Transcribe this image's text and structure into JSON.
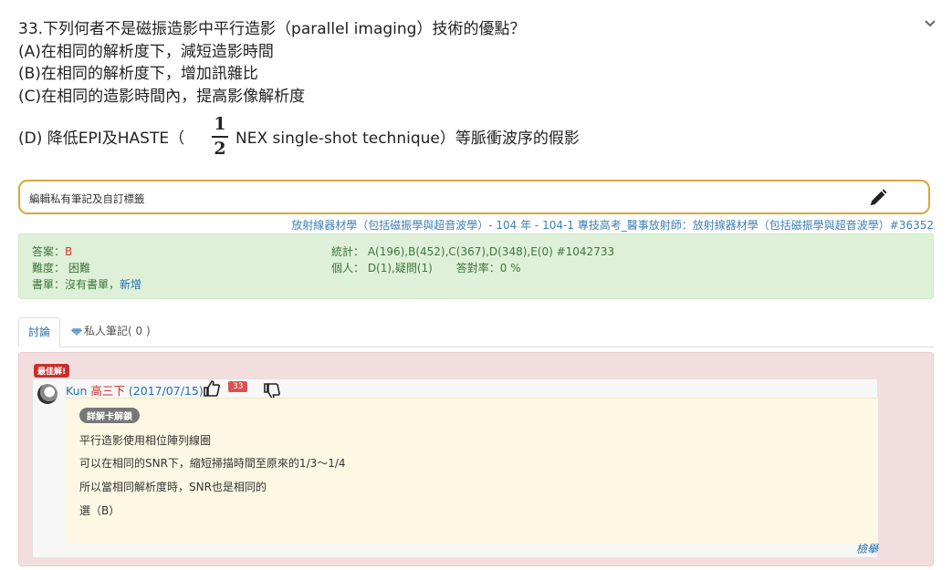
{
  "question": {
    "title": "33.下列何者不是磁振造影中平行造影（parallel imaging）技術的優點？",
    "option_a": "(A)在相同的解析度下，減短造影時間",
    "option_b": "(B)在相同的解析度下，增加訊雜比",
    "option_c": "(C)在相同的造影時間內，提高影像解析度",
    "option_d_prefix": "(D) 降低EPI及HASTE（",
    "option_d_frac_num": "1",
    "option_d_frac_den": "2",
    "option_d_suffix": "NEX single-shot technique）等脈衝波序的假影"
  },
  "note": {
    "label": "編輯私有筆記及自訂標籤"
  },
  "source": "放射線器材學（包括磁振學與超音波學）- 104 年 - 104-1 專技高考_醫事放射師：放射線器材學（包括磁振學與超音波學）#36352",
  "answer": {
    "answer_label": "答案：",
    "answer_value": "B",
    "difficulty": "難度： 困難",
    "book_label": "書單：沒有書單，",
    "book_link": "新增",
    "stats": "統計： A(196),B(452),C(367),D(348),E(0) #1042733",
    "personal": "個人： D(1),疑問(1)",
    "accuracy": "答對率：0 %"
  },
  "tabs": {
    "discussion": "討論",
    "private": "私人筆記( 0 )"
  },
  "discussion": {
    "best_badge": "最佳解!",
    "user": "Kun",
    "rank": "高三下",
    "date": "(2017/07/15)",
    "likes": "33",
    "tag": "詳解卡解鎖",
    "lines": [
      "平行造影使用相位陣列線圈",
      "可以在相同的SNR下，縮短掃描時間至原來的1/3～1/4",
      "所以當相同解析度時，SNR也是相同的",
      "選（B）"
    ],
    "report": "檢舉"
  },
  "colors": {
    "accent": "#2a6fb0",
    "answer_bg": "#dff0d8",
    "discussion_bg": "#f2dede",
    "note_border": "#d7a83a"
  }
}
